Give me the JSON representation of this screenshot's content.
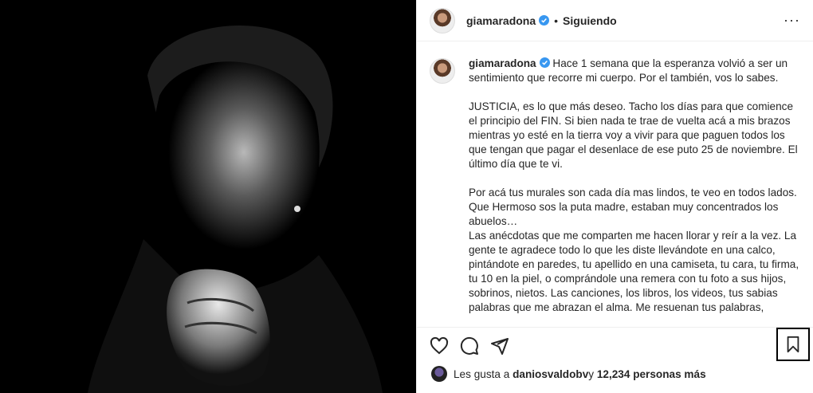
{
  "post": {
    "username": "giamaradona",
    "separator": "•",
    "follow_label": "Siguiendo",
    "more_label": "···"
  },
  "caption": {
    "username": "giamaradona",
    "paragraphs": [
      "Hace 1 semana que la esperanza volvió a ser un sentimiento que recorre mi cuerpo. Por el también, vos lo sabes.",
      "JUSTICIA, es lo que más deseo. Tacho los días para que comience el principio del FIN. Si bien nada te trae de vuelta acá a mis brazos mientras yo esté en la tierra voy a vivir para que paguen todos los que tengan que pagar el desenlace de ese puto 25 de noviembre. El último día que te vi.",
      "Por acá tus murales son cada día mas lindos, te veo en todos lados. Que Hermoso sos la puta madre, estaban muy concentrados los abuelos…\nLas anécdotas que me comparten me hacen llorar y reír a la vez. La gente te agradece todo lo que les diste llevándote en una calco, pintándote en paredes, tu apellido en una camiseta, tu cara, tu firma, tu 10 en la piel, o comprándole una remera con tu foto a sus hijos, sobrinos, nietos. Las canciones, los libros, los videos, tus sabias palabras que me abrazan el alma. Me resuenan tus palabras,"
    ]
  },
  "likes": {
    "prefix": "Les gusta a ",
    "user": "daniosvaldobv",
    "middle": " y ",
    "count": "12,234 personas más"
  },
  "icons": {
    "like": "heart-icon",
    "comment": "comment-icon",
    "share": "share-icon",
    "save": "bookmark-icon",
    "verified": "verified-badge-icon"
  },
  "colors": {
    "verified": "#3897f0",
    "text": "#262626"
  }
}
